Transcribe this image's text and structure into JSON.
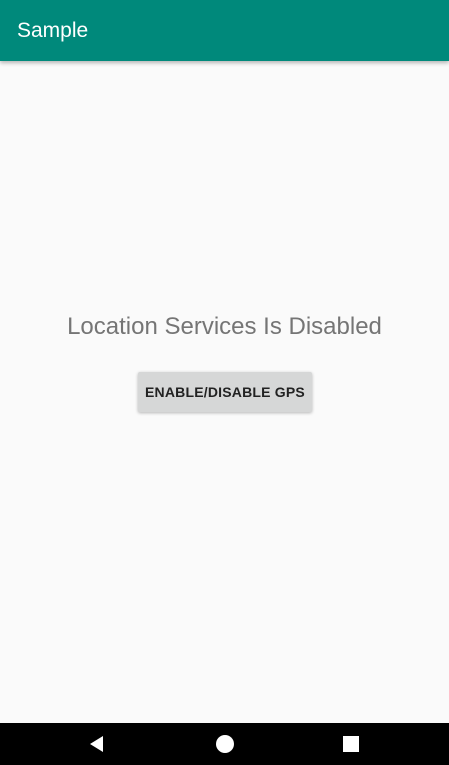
{
  "app_bar": {
    "title": "Sample",
    "color": "#00897b"
  },
  "main": {
    "status_text": "Location Services Is Disabled",
    "button_label": "ENABLE/DISABLE GPS"
  },
  "nav_bar": {
    "back_icon": "back-triangle-icon",
    "home_icon": "home-circle-icon",
    "recents_icon": "recents-square-icon"
  }
}
